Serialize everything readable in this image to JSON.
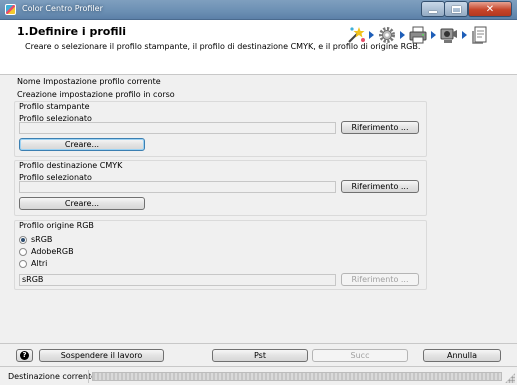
{
  "window": {
    "title": "Color Centro Profiler"
  },
  "header": {
    "step_title": "1.Definire i profili",
    "step_description": "Creare o selezionare il profilo stampante, il profilo di destinazione CMYK, e il profilo di origine RGB.",
    "step_icons": [
      "wand-icon",
      "gear-icon",
      "printer-icon",
      "eye-icon",
      "document-icon"
    ]
  },
  "current": {
    "setting_name_label": "Nome Impostazione profilo corrente",
    "setting_status": "Creazione impostazione profilo in corso"
  },
  "printer_profile": {
    "group_title": "Profilo stampante",
    "selected_label": "Profilo selezionato",
    "selected_value": "",
    "browse_label": "Riferimento ...",
    "create_label": "Creare..."
  },
  "cmyk_profile": {
    "group_title": "Profilo destinazione CMYK",
    "selected_label": "Profilo selezionato",
    "selected_value": "",
    "browse_label": "Riferimento ...",
    "create_label": "Creare..."
  },
  "rgb_profile": {
    "group_title": "Profilo origine RGB",
    "options": [
      "sRGB",
      "AdobeRGB",
      "Altri"
    ],
    "selected_index": 0,
    "selected_value": "sRGB",
    "browse_label": "Riferimento ..."
  },
  "footer": {
    "suspend_label": "Sospendere il lavoro",
    "back_label": "Pst",
    "next_label": "Succ",
    "cancel_label": "Annulla"
  },
  "statusbar": {
    "text": "Destinazione corrente"
  },
  "colors": {
    "titlebar": "#6b8fb3",
    "close": "#c6452a",
    "step_arrow": "#1e5eb8",
    "focus_border": "#3c7fb1"
  }
}
